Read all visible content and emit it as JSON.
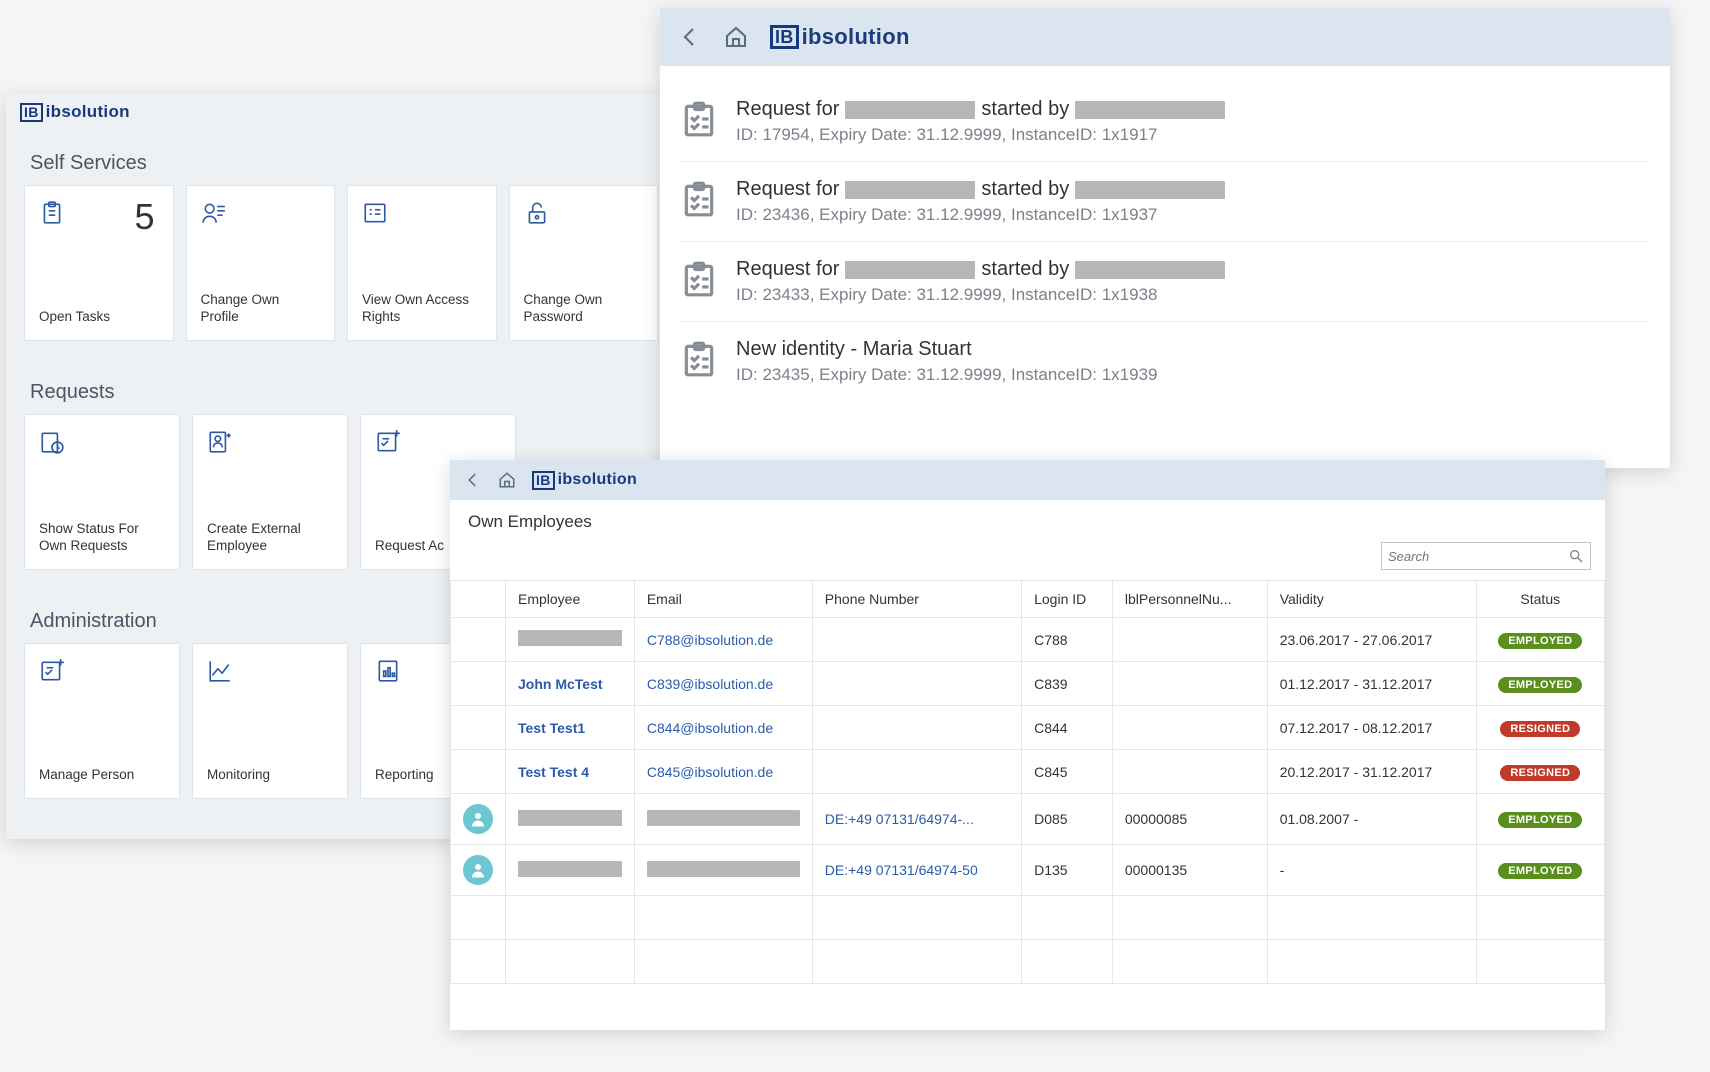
{
  "brand": "IBsolution",
  "win1": {
    "sections": [
      {
        "title": "Self Services",
        "tiles": [
          {
            "label": "Open Tasks",
            "icon": "clipboard",
            "count": "5"
          },
          {
            "label": "Change Own Profile",
            "icon": "profile"
          },
          {
            "label": "View Own Access Rights",
            "icon": "list"
          },
          {
            "label": "Change Own Password",
            "icon": "unlock"
          }
        ]
      },
      {
        "title": "Requests",
        "tiles": [
          {
            "label": "Show Status For Own Requests",
            "icon": "clock"
          },
          {
            "label": "Create External Employee",
            "icon": "newperson"
          },
          {
            "label": "Request Ac",
            "icon": "addpanel"
          }
        ]
      },
      {
        "title": "Administration",
        "tiles": [
          {
            "label": "Manage Person",
            "icon": "addpanel"
          },
          {
            "label": "Monitoring",
            "icon": "chart"
          },
          {
            "label": "Reporting",
            "icon": "report"
          }
        ]
      }
    ]
  },
  "win2": {
    "items": [
      {
        "title_before": "Request for",
        "title_mid": "started by",
        "sub": "ID: 17954, Expiry Date: 31.12.9999, InstanceID: 1x1917",
        "redacted": true
      },
      {
        "title_before": "Request for",
        "title_mid": "started by",
        "sub": "ID: 23436, Expiry Date: 31.12.9999, InstanceID: 1x1937",
        "redacted": true
      },
      {
        "title_before": "Request for",
        "title_mid": "started by",
        "sub": "ID: 23433, Expiry Date: 31.12.9999, InstanceID: 1x1938",
        "redacted": true
      },
      {
        "title_full": "New identity - Maria Stuart",
        "sub": "ID: 23435, Expiry Date: 31.12.9999, InstanceID: 1x1939",
        "redacted": false
      }
    ]
  },
  "win3": {
    "title": "Own Employees",
    "search_placeholder": "Search",
    "columns": [
      "Employee",
      "Email",
      "Phone Number",
      "Login ID",
      "lblPersonnelNu...",
      "Validity",
      "Status"
    ],
    "rows": [
      {
        "avatar": false,
        "employee_redacted": true,
        "employee": "",
        "email": "C788@ibsolution.de",
        "phone": "",
        "login": "C788",
        "personnel": "",
        "validity": "23.06.2017 - 27.06.2017",
        "status": "EMPLOYED"
      },
      {
        "avatar": false,
        "employee": "John McTest",
        "email": "C839@ibsolution.de",
        "phone": "",
        "login": "C839",
        "personnel": "",
        "validity": "01.12.2017 - 31.12.2017",
        "status": "EMPLOYED"
      },
      {
        "avatar": false,
        "employee": "Test Test1",
        "email": "C844@ibsolution.de",
        "phone": "",
        "login": "C844",
        "personnel": "",
        "validity": "07.12.2017 - 08.12.2017",
        "status": "RESIGNED"
      },
      {
        "avatar": false,
        "employee": "Test Test 4",
        "email": "C845@ibsolution.de",
        "phone": "",
        "login": "C845",
        "personnel": "",
        "validity": "20.12.2017 - 31.12.2017",
        "status": "RESIGNED"
      },
      {
        "avatar": true,
        "employee_redacted": true,
        "email_redacted": true,
        "phone": "DE:+49 07131/64974-...",
        "login": "D085",
        "personnel": "00000085",
        "validity": "01.08.2007 -",
        "status": "EMPLOYED"
      },
      {
        "avatar": true,
        "employee_redacted": true,
        "email_redacted": true,
        "phone": "DE:+49 07131/64974-50",
        "login": "D135",
        "personnel": "00000135",
        "validity": "-",
        "status": "EMPLOYED"
      }
    ],
    "empty_rows": 2
  }
}
